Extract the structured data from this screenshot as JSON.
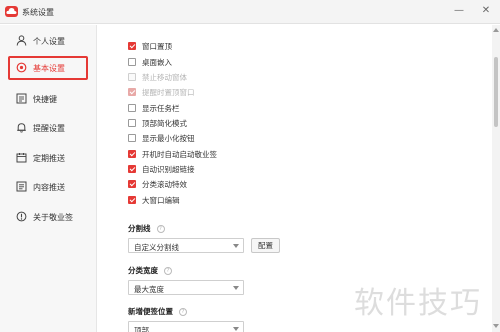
{
  "window": {
    "title": "系统设置",
    "minimize_glyph": "—",
    "close_glyph": "✕"
  },
  "sidebar": {
    "items": [
      {
        "label": "个人设置",
        "icon": "person-icon",
        "active": false
      },
      {
        "label": "基本设置",
        "icon": "settings-circle-icon",
        "active": true
      },
      {
        "label": "快捷键",
        "icon": "keyboard-icon",
        "active": false
      },
      {
        "label": "提醒设置",
        "icon": "bell-icon",
        "active": false
      },
      {
        "label": "定期推送",
        "icon": "calendar-icon",
        "active": false
      },
      {
        "label": "内容推送",
        "icon": "document-icon",
        "active": false
      },
      {
        "label": "关于敬业签",
        "icon": "info-icon",
        "active": false
      }
    ]
  },
  "options": [
    {
      "label": "窗口置顶",
      "checked": true,
      "disabled": false
    },
    {
      "label": "桌面嵌入",
      "checked": false,
      "disabled": false
    },
    {
      "label": "禁止移动窗体",
      "checked": false,
      "disabled": true
    },
    {
      "label": "提醒时置顶窗口",
      "checked": true,
      "disabled": true
    },
    {
      "label": "显示任务栏",
      "checked": false,
      "disabled": false
    },
    {
      "label": "顶部简化模式",
      "checked": false,
      "disabled": false
    },
    {
      "label": "显示最小化按钮",
      "checked": false,
      "disabled": false
    },
    {
      "label": "开机时自动启动敬业签",
      "checked": true,
      "disabled": false
    },
    {
      "label": "自动识别超链接",
      "checked": true,
      "disabled": false
    },
    {
      "label": "分类滚动特效",
      "checked": true,
      "disabled": false
    },
    {
      "label": "大窗口编辑",
      "checked": true,
      "disabled": false
    }
  ],
  "divider_section": {
    "label": "分割线",
    "help": "?",
    "select_value": "自定义分割线",
    "config_button": "配置"
  },
  "category_width_section": {
    "label": "分类宽度",
    "help": "?",
    "select_value": "最大宽度"
  },
  "new_note_section": {
    "label": "新增便签位置",
    "help": "?",
    "select_value": "顶部"
  },
  "watermark": "软件技巧",
  "colors": {
    "accent": "#e53935",
    "sidebar_bg": "#f7f7f7",
    "titlebar_bg": "#f4f4f4"
  }
}
